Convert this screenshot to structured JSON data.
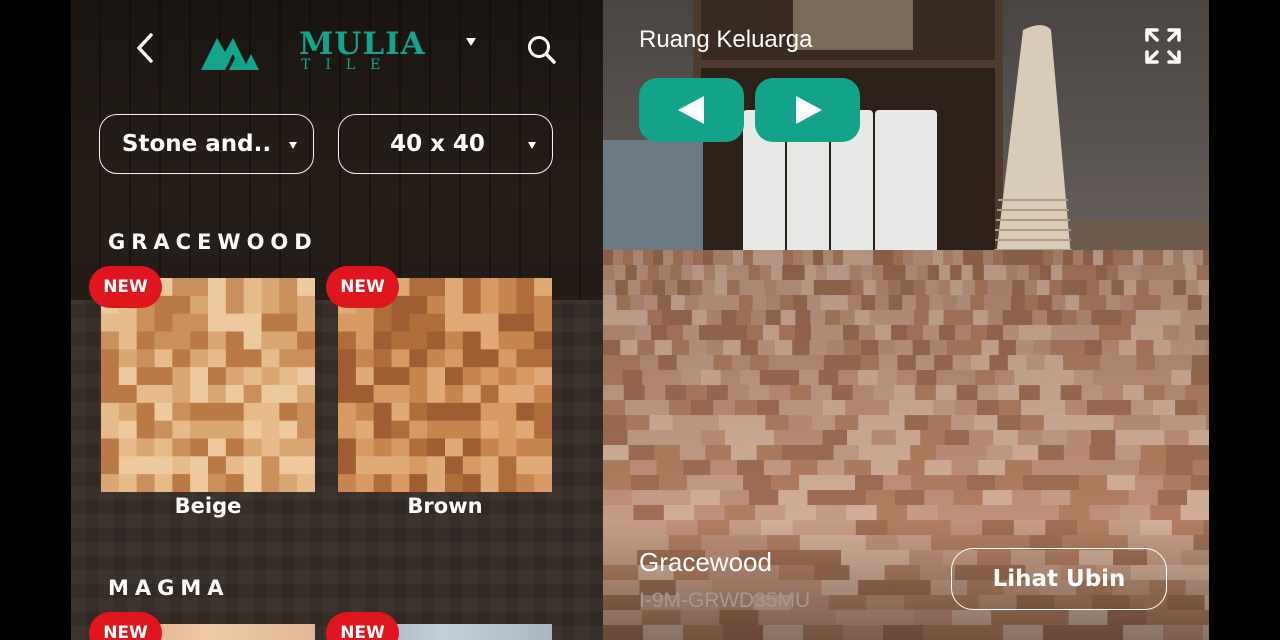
{
  "header": {
    "brand_name": "MULIA",
    "brand_sub": "TILE"
  },
  "filters": {
    "category": "Stone and..",
    "size": "40 x 40"
  },
  "collections": [
    {
      "name": "GRACEWOOD",
      "tiles": [
        {
          "label": "Beige",
          "badge": "NEW"
        },
        {
          "label": "Brown",
          "badge": "NEW"
        }
      ]
    },
    {
      "name": "MAGMA",
      "tiles": [
        {
          "label": "",
          "badge": "NEW"
        },
        {
          "label": "",
          "badge": "NEW"
        }
      ]
    }
  ],
  "preview": {
    "room_name": "Ruang Keluarga",
    "product_name": "Gracewood",
    "product_code": "I-9M-GRWD35MU",
    "view_button": "Lihat Ubin"
  },
  "colors": {
    "accent": "#12a38a",
    "badge": "#e0161f"
  },
  "icons": [
    "back-icon",
    "search-icon",
    "expand-icon",
    "arrow-left-icon",
    "arrow-right-icon",
    "chevron-down-icon"
  ]
}
